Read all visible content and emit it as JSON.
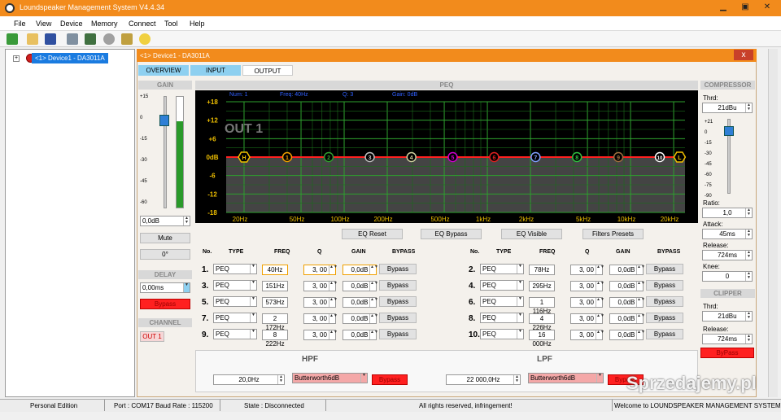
{
  "title": "Loundspeaker Management System V4.4.34",
  "menu": [
    "File",
    "View",
    "Device",
    "Memory",
    "Connect",
    "Tool",
    "Help"
  ],
  "tree": {
    "device": "<1> Device1 - DA3011A",
    "expander": "+"
  },
  "window": {
    "title": "<1> Device1 - DA3011A",
    "close": "x"
  },
  "tabs": [
    "OVERVIEW",
    "INPUT",
    "OUTPUT"
  ],
  "gain": {
    "header": "GAIN",
    "ticks": [
      "+15",
      "0",
      "-15",
      "-30",
      "-45",
      "-60"
    ],
    "value": "0,0dB",
    "level": 0.78,
    "mute": "Mute",
    "phase": "0°"
  },
  "delay": {
    "header": "DELAY",
    "value": "0,00ms",
    "bypass": "Bypass"
  },
  "channel": {
    "header": "CHANNEL",
    "value": "OUT 1"
  },
  "peq": {
    "header": "PEQ",
    "info": {
      "num": "Num: 1",
      "freq": "Freq: 40Hz",
      "q": "Q: 3",
      "gain": "Gain: 0dB"
    },
    "label": "OUT 1"
  },
  "chart_data": {
    "type": "line",
    "title": "",
    "ylim": [
      -18,
      18
    ],
    "grid": true,
    "y_ticks": [
      "+18",
      "+12",
      "+6",
      "0dB",
      "-6",
      "-12",
      "-18"
    ],
    "x_ticks": [
      "20Hz",
      "50Hz",
      "100Hz",
      "200Hz",
      "500Hz",
      "1kHz",
      "2kHz",
      "5kHz",
      "10kHz",
      "20kHz"
    ],
    "x_tick_values": [
      20,
      50,
      100,
      200,
      500,
      1000,
      2000,
      5000,
      10000,
      20000
    ],
    "series": [
      {
        "values": [
          0,
          0
        ]
      }
    ],
    "points": [
      {
        "label": "H",
        "color": "#f0c000",
        "freq": 20
      },
      {
        "label": "1",
        "color": "#f0a000",
        "freq": 40
      },
      {
        "label": "2",
        "color": "#30a030",
        "freq": 78
      },
      {
        "label": "3",
        "color": "#c0c0c0",
        "freq": 151
      },
      {
        "label": "4",
        "color": "#d0d0a0",
        "freq": 295
      },
      {
        "label": "5",
        "color": "#d000d0",
        "freq": 573
      },
      {
        "label": "6",
        "color": "#e02020",
        "freq": 1116
      },
      {
        "label": "7",
        "color": "#80a0ff",
        "freq": 2172
      },
      {
        "label": "8",
        "color": "#30c040",
        "freq": 4226
      },
      {
        "label": "9",
        "color": "#a07040",
        "freq": 8222
      },
      {
        "label": "10",
        "color": "#ffffff",
        "freq": 16000
      },
      {
        "label": "L",
        "color": "#f0c000",
        "freq": 22000
      }
    ]
  },
  "eq_buttons": [
    "EQ Reset",
    "EQ Bypass",
    "EQ Visible",
    "Filters Presets"
  ],
  "table_headers": [
    "No.",
    "TYPE",
    "FREQ",
    "Q",
    "GAIN",
    "BYPASS"
  ],
  "bands_left": [
    {
      "no": "1.",
      "type": "PEQ",
      "freq": "40Hz",
      "q": "3, 00",
      "gain": "0,0dB",
      "bypass": "Bypass"
    },
    {
      "no": "3.",
      "type": "PEQ",
      "freq": "151Hz",
      "q": "3, 00",
      "gain": "0,0dB",
      "bypass": "Bypass"
    },
    {
      "no": "5.",
      "type": "PEQ",
      "freq": "573Hz",
      "q": "3, 00",
      "gain": "0,0dB",
      "bypass": "Bypass"
    },
    {
      "no": "7.",
      "type": "PEQ",
      "freq": "2 172Hz",
      "q": "3, 00",
      "gain": "0,0dB",
      "bypass": "Bypass"
    },
    {
      "no": "9.",
      "type": "PEQ",
      "freq": "8 222Hz",
      "q": "3, 00",
      "gain": "0,0dB",
      "bypass": "Bypass"
    }
  ],
  "bands_right": [
    {
      "no": "2.",
      "type": "PEQ",
      "freq": "78Hz",
      "q": "3, 00",
      "gain": "0,0dB",
      "bypass": "Bypass"
    },
    {
      "no": "4.",
      "type": "PEQ",
      "freq": "295Hz",
      "q": "3, 00",
      "gain": "0,0dB",
      "bypass": "Bypass"
    },
    {
      "no": "6.",
      "type": "PEQ",
      "freq": "1 116Hz",
      "q": "3, 00",
      "gain": "0,0dB",
      "bypass": "Bypass"
    },
    {
      "no": "8.",
      "type": "PEQ",
      "freq": "4 226Hz",
      "q": "3, 00",
      "gain": "0,0dB",
      "bypass": "Bypass"
    },
    {
      "no": "10.",
      "type": "PEQ",
      "freq": "16 000Hz",
      "q": "3, 00",
      "gain": "0,0dB",
      "bypass": "Bypass"
    }
  ],
  "hpf": {
    "header": "HPF",
    "freq": "20,0Hz",
    "type": "Butterworth6dB",
    "bypass": "Bypass"
  },
  "lpf": {
    "header": "LPF",
    "freq": "22 000,0Hz",
    "type": "Butterworth6dB",
    "bypass": "Bypass"
  },
  "compressor": {
    "header": "COMPRESSOR",
    "thrd_label": "Thrd:",
    "thrd": "21dBu",
    "ticks": [
      "+21",
      "0",
      "-15",
      "-30",
      "-45",
      "-60",
      "-75",
      "-90"
    ],
    "level": 0.1,
    "ratio_label": "Ratio:",
    "ratio": "1,0",
    "attack_label": "Attack:",
    "attack": "45ms",
    "release_label": "Release:",
    "release": "724ms",
    "knee_label": "Knee:",
    "knee": "0"
  },
  "clipper": {
    "header": "CLIPPER",
    "thrd_label": "Thrd:",
    "thrd": "21dBu",
    "release_label": "Release:",
    "release": "724ms",
    "bypass": "ByPass"
  },
  "status": {
    "edition": "Personal Edition",
    "port": "Port : COM17  Baud Rate : 115200",
    "state": "State : Disconnected",
    "rights": "All rights reserved, infringement!",
    "welcome": "Welcome to LOUNDSPEAKER MANAGEMENT SYSTEM"
  },
  "watermark": "Sprzedajemy.pl"
}
